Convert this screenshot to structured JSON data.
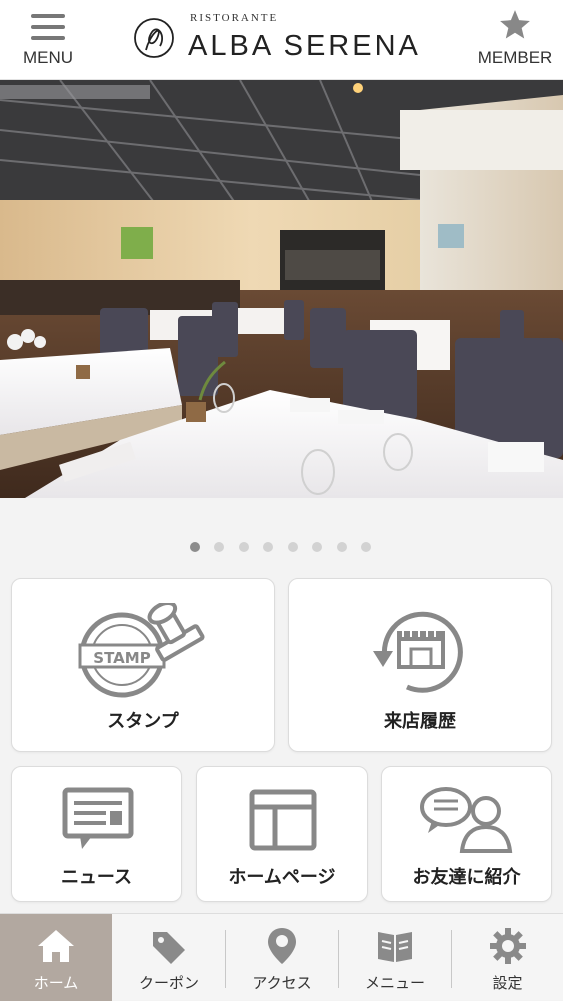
{
  "header": {
    "menu_label": "MENU",
    "logo_small": "RISTORANTE",
    "logo_big": "ALBA SERENA",
    "member_label": "MEMBER"
  },
  "carousel": {
    "slide_count": 8,
    "active_index": 0
  },
  "tiles": {
    "stamp": {
      "label": "スタンプ",
      "stamp_text": "STAMP"
    },
    "history": {
      "label": "来店履歴"
    },
    "news": {
      "label": "ニュース"
    },
    "homepage": {
      "label": "ホームページ"
    },
    "invite": {
      "label": "お友達に紹介"
    }
  },
  "tabbar": {
    "items": [
      {
        "label": "ホーム",
        "icon": "home-icon"
      },
      {
        "label": "クーポン",
        "icon": "tag-icon"
      },
      {
        "label": "アクセス",
        "icon": "location-pin-icon"
      },
      {
        "label": "メニュー",
        "icon": "book-icon"
      },
      {
        "label": "設定",
        "icon": "gear-icon"
      }
    ],
    "active_index": 0
  },
  "colors": {
    "icon_gray": "#8a8a8a",
    "tab_active_bg": "#b2a8a0"
  }
}
